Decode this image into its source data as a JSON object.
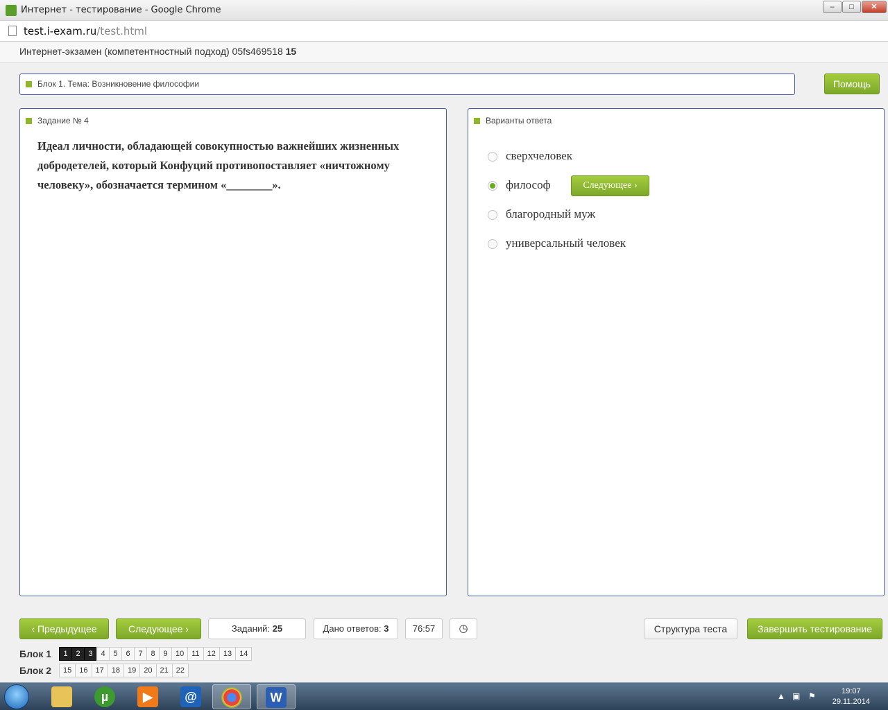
{
  "window": {
    "title": "Интернет - тестирование - Google Chrome"
  },
  "browser": {
    "url_host": "test.i-exam.ru",
    "url_path": "/test.html"
  },
  "exam_header": {
    "title": "Интернет-экзамен (компетентностный подход) 05fs469518",
    "number": "15"
  },
  "block_bar": {
    "text": "Блок 1. Тема: Возникновение философии"
  },
  "help_button": {
    "label": "Помощь"
  },
  "task_panel": {
    "label": "Задание № 4",
    "question": "Идеал личности, обладающей совокупностью важнейших жизненных добродетелей, который Конфуций противопоставляет «ничтожному человеку», обозначается термином «________»."
  },
  "answer_panel": {
    "label": "Варианты ответа",
    "options": [
      {
        "text": "сверхчеловек",
        "selected": false
      },
      {
        "text": "философ",
        "selected": true
      },
      {
        "text": "благородный муж",
        "selected": false
      },
      {
        "text": "универсальный человек",
        "selected": false
      }
    ],
    "next_inline_label": "Следующее"
  },
  "bottom": {
    "prev_label": "Предыдущее",
    "next_label": "Следующее",
    "tasks_label": "Заданий:",
    "tasks_count": "25",
    "answers_label": "Дано ответов:",
    "answers_count": "3",
    "timer": "76:57",
    "structure_label": "Структура теста",
    "finish_label": "Завершить тестирование"
  },
  "blocks": [
    {
      "label": "Блок 1",
      "numbers": [
        "1",
        "2",
        "3",
        "4",
        "5",
        "6",
        "7",
        "8",
        "9",
        "10",
        "11",
        "12",
        "13",
        "14"
      ],
      "done": [
        "1",
        "2",
        "3"
      ]
    },
    {
      "label": "Блок 2",
      "numbers": [
        "15",
        "16",
        "17",
        "18",
        "19",
        "20",
        "21",
        "22"
      ],
      "done": []
    }
  ],
  "taskbar": {
    "time": "19:07",
    "date": "29.11.2014"
  },
  "colors": {
    "accent_green": "#8db82c",
    "panel_border": "#4a5ca8",
    "selected_radio": "#6bab1e"
  }
}
